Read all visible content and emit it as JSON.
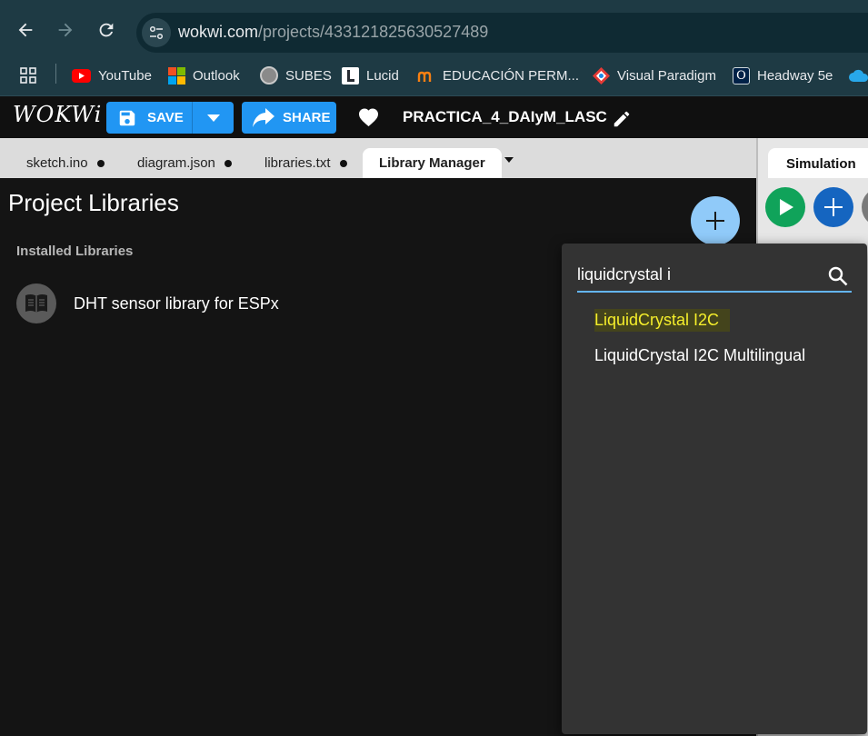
{
  "browser": {
    "url_domain": "wokwi.com",
    "url_path": "/projects/433121825630527489",
    "bookmarks": [
      {
        "label": "YouTube",
        "icon": "youtube-icon",
        "color": "#ff0000"
      },
      {
        "label": "Outlook",
        "icon": "microsoft-icon",
        "color": "#f25022"
      },
      {
        "label": "SUBES",
        "icon": "seal-icon",
        "color": "#9e9e9e"
      },
      {
        "label": "Lucid",
        "icon": "lucid-icon",
        "color": "#ffffff"
      },
      {
        "label": "EDUCACIÓN PERM...",
        "icon": "moodle-icon",
        "color": "#f98012"
      },
      {
        "label": "Visual Paradigm",
        "icon": "visual-paradigm-icon",
        "color": "#e53935"
      },
      {
        "label": "Headway 5e",
        "icon": "oxford-icon",
        "color": "#002147"
      }
    ]
  },
  "header": {
    "logo": "WOKWi",
    "save_label": "SAVE",
    "share_label": "SHARE",
    "project_title": "PRACTICA_4_DAIyM_LASC"
  },
  "tabs": [
    {
      "label": "sketch.ino",
      "modified": true
    },
    {
      "label": "diagram.json",
      "modified": true
    },
    {
      "label": "libraries.txt",
      "modified": true
    },
    {
      "label": "Library Manager",
      "active": true
    }
  ],
  "simulation_tab": "Simulation",
  "library_manager": {
    "title": "Project Libraries",
    "installed_label": "Installed Libraries",
    "installed": [
      "DHT sensor library for ESPx"
    ]
  },
  "search": {
    "value": "liquidcrystal i",
    "results": [
      "LiquidCrystal I2C",
      "LiquidCrystal I2C Multilingual"
    ]
  },
  "colors": {
    "accent": "#2196f3",
    "highlight_text": "#f5ee2b",
    "play_green": "#10a35a"
  }
}
